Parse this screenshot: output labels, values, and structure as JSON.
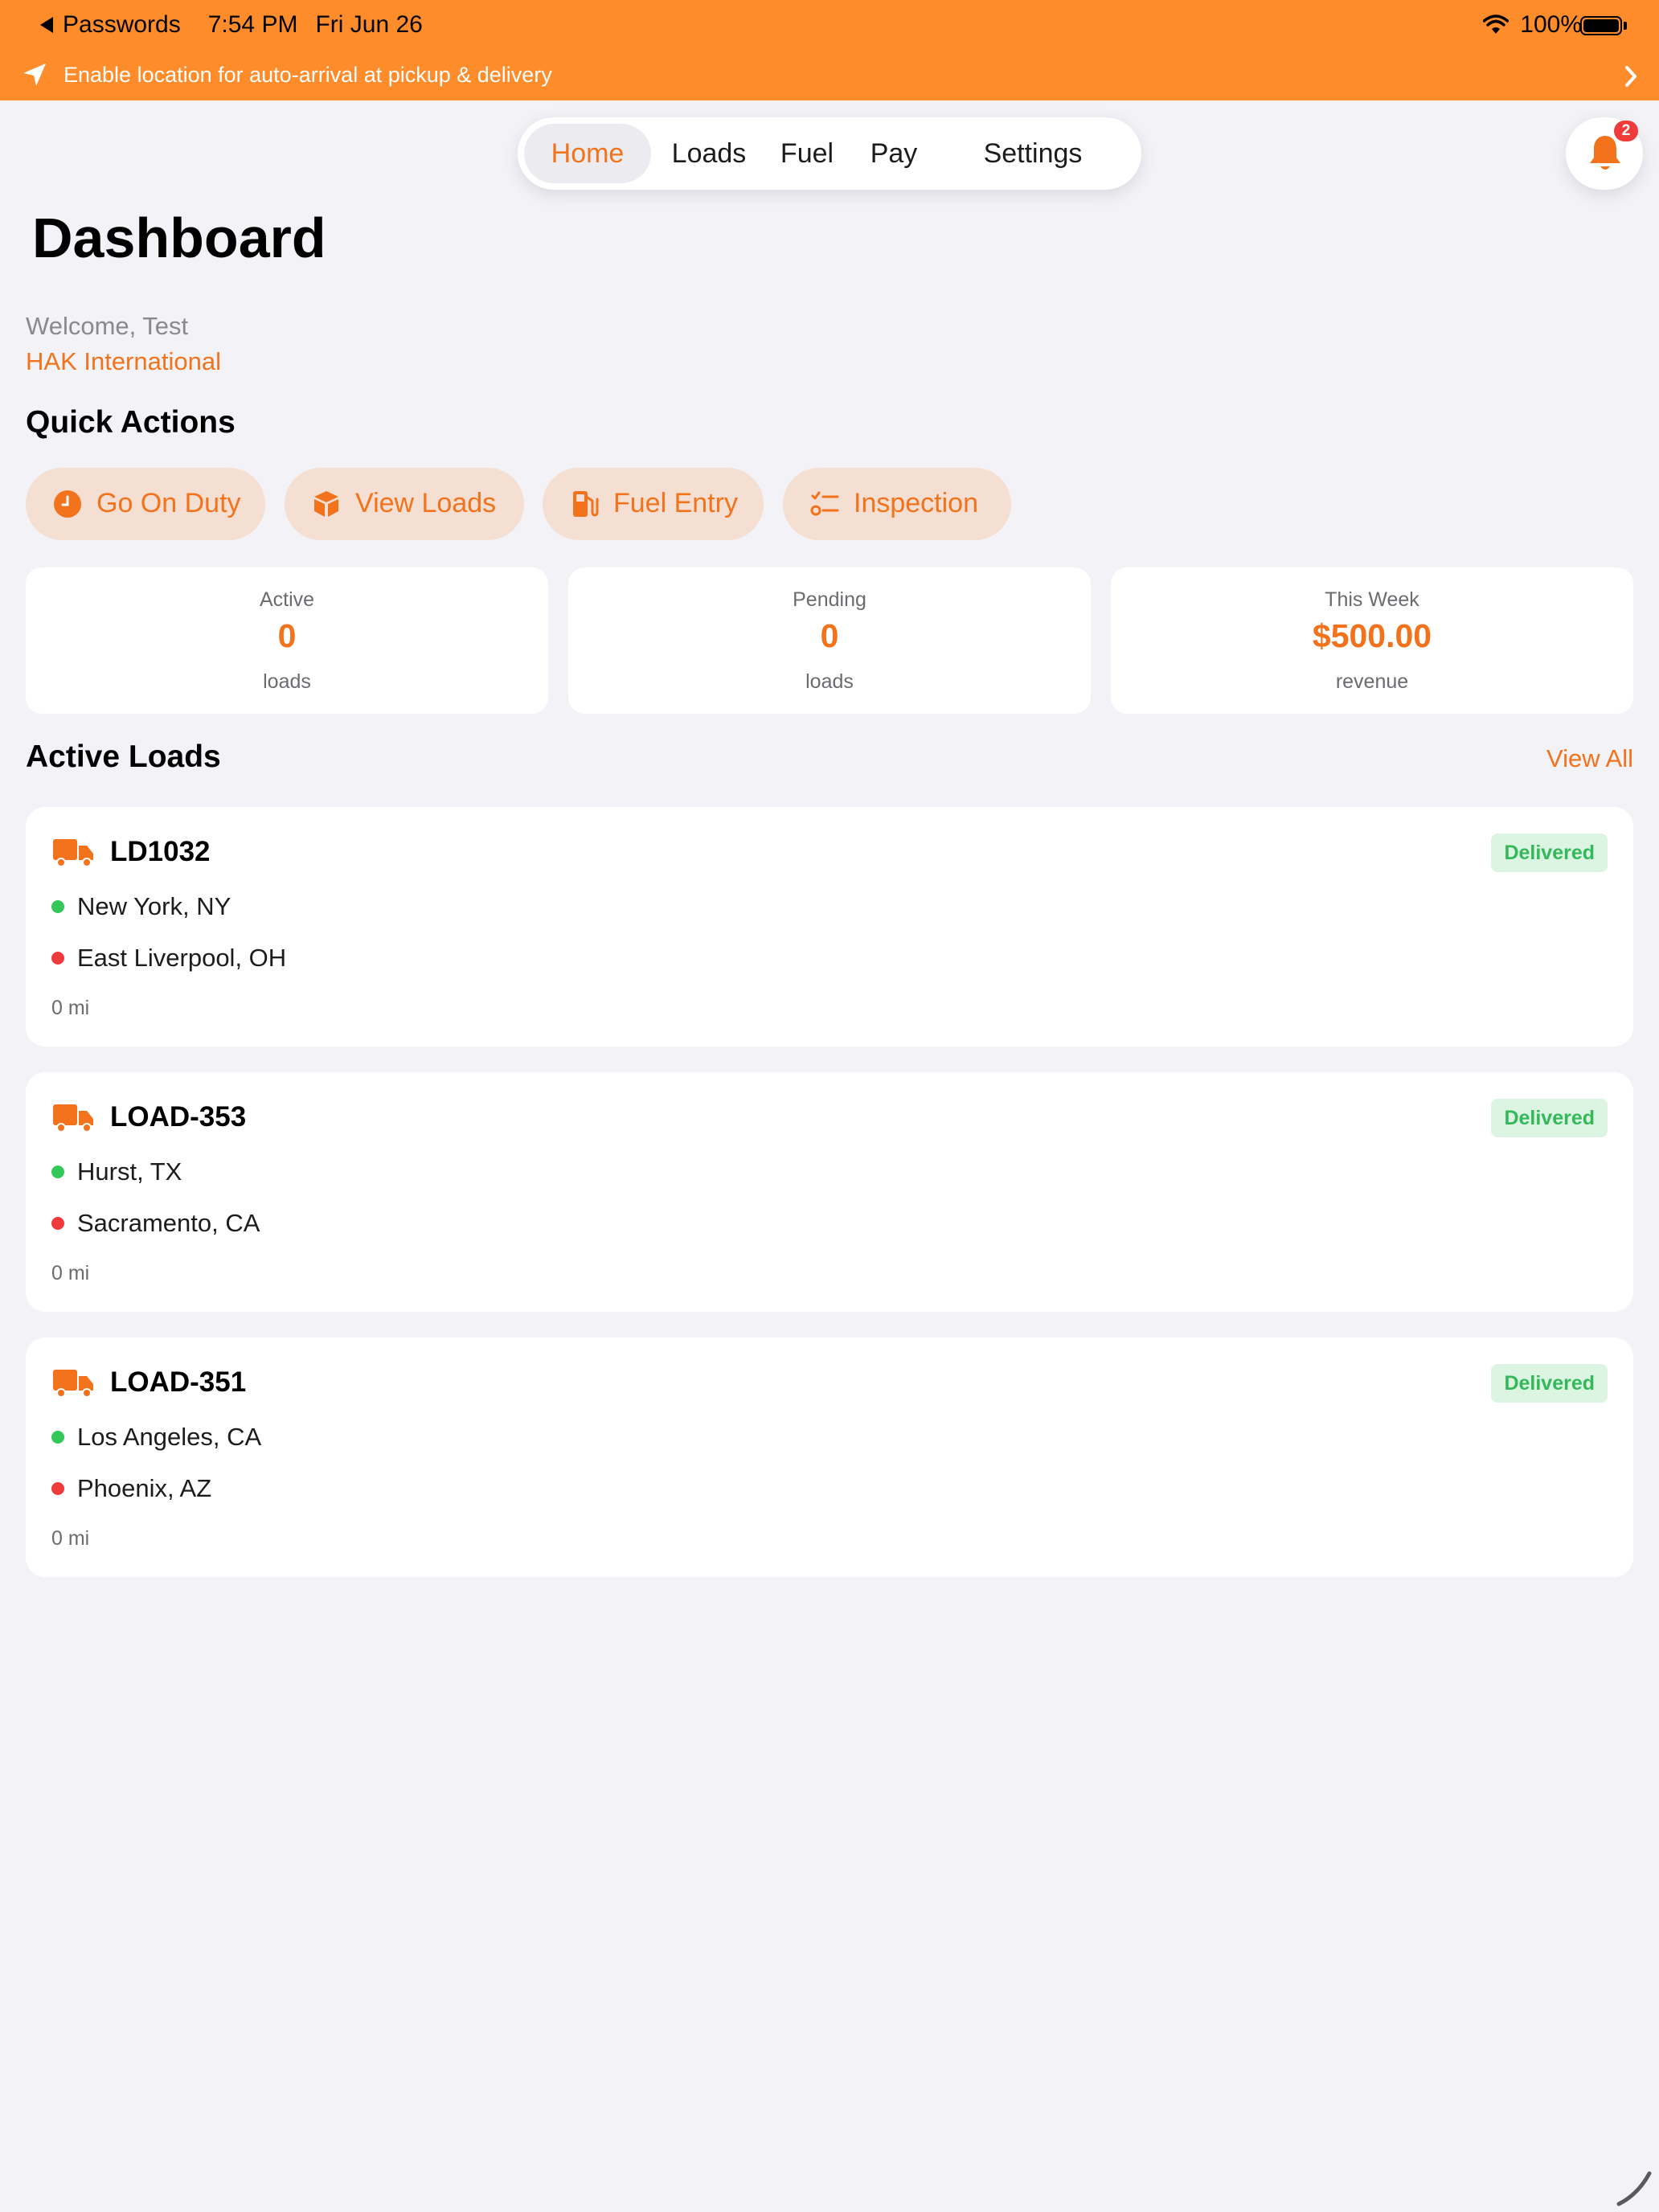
{
  "status_bar": {
    "back_app": "Passwords",
    "time": "7:54 PM",
    "date": "Fri Jun 26",
    "battery": "100%"
  },
  "location_banner": {
    "text": "Enable location for auto-arrival at pickup & delivery"
  },
  "tabs": [
    {
      "label": "Home",
      "active": true
    },
    {
      "label": "Loads",
      "active": false
    },
    {
      "label": "Fuel",
      "active": false
    },
    {
      "label": "Pay",
      "active": false
    },
    {
      "label": "Settings",
      "active": false
    }
  ],
  "notifications": {
    "count": "2"
  },
  "page": {
    "title": "Dashboard",
    "welcome": "Welcome, Test",
    "company": "HAK International"
  },
  "quick_actions": {
    "title": "Quick Actions",
    "buttons": [
      {
        "label": "Go On Duty",
        "icon": "clock-icon"
      },
      {
        "label": "View Loads",
        "icon": "package-icon"
      },
      {
        "label": "Fuel Entry",
        "icon": "fuel-pump-icon"
      },
      {
        "label": "Inspection",
        "icon": "checklist-icon"
      }
    ]
  },
  "stats": [
    {
      "label": "Active",
      "value": "0",
      "unit": "loads"
    },
    {
      "label": "Pending",
      "value": "0",
      "unit": "loads"
    },
    {
      "label": "This Week",
      "value": "$500.00",
      "unit": "revenue"
    }
  ],
  "active_loads": {
    "title": "Active Loads",
    "view_all": "View All",
    "items": [
      {
        "id": "LD1032",
        "status": "Delivered",
        "origin": "New York, NY",
        "destination": "East Liverpool, OH",
        "miles": "0 mi"
      },
      {
        "id": "LOAD-353",
        "status": "Delivered",
        "origin": "Hurst, TX",
        "destination": "Sacramento, CA",
        "miles": "0 mi"
      },
      {
        "id": "LOAD-351",
        "status": "Delivered",
        "origin": "Los Angeles, CA",
        "destination": "Phoenix, AZ",
        "miles": "0 mi"
      }
    ]
  },
  "colors": {
    "accent": "#f2731c",
    "banner": "#ff8c2a",
    "delivered_bg": "#dcf5e2",
    "delivered_text": "#34b85a",
    "origin_dot": "#34c759",
    "destination_dot": "#ef3b3b"
  }
}
